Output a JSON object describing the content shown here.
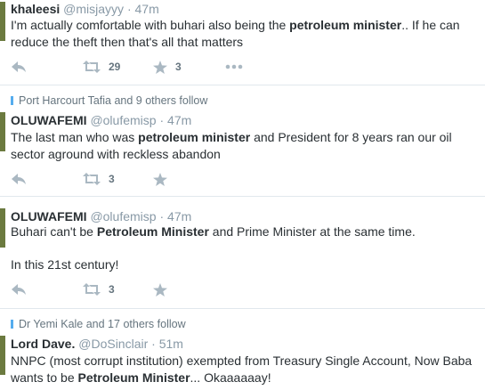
{
  "tweets": [
    {
      "name": "khaleesi",
      "handle": "@misjayyy",
      "dot": "·",
      "time": "47m",
      "text_parts": [
        "I'm actually comfortable with buhari also being the ",
        "petroleum minister",
        ".. If he can reduce the theft then that's all that matters"
      ],
      "retweets": "29",
      "favorites": "3"
    },
    {
      "social": "Port Harcourt Tafia and 9 others follow",
      "name": "OLUWAFEMI",
      "handle": "@olufemisp",
      "dot": "·",
      "time": "47m",
      "text_parts": [
        "The last man who was ",
        "petroleum minister",
        " and President for 8 years ran our oil sector aground with reckless abandon"
      ],
      "retweets": "3"
    },
    {
      "name": "OLUWAFEMI",
      "handle": "@olufemisp",
      "dot": "·",
      "time": "47m",
      "text_parts": [
        "Buhari can't be ",
        "Petroleum Minister",
        " and Prime Minister at the same time."
      ],
      "text_line2": "In this 21st century!",
      "retweets": "3"
    },
    {
      "social": "Dr Yemi Kale and 17 others follow",
      "name": "Lord Dave.",
      "handle": "@DoSinclair",
      "dot": "·",
      "time": "51m",
      "text_parts": [
        "NNPC (most corrupt institution) exempted from Treasury Single Account, Now Baba wants to be ",
        "Petroleum Minister",
        "... Okaaaaaay!"
      ]
    }
  ],
  "colors": {
    "icon": "#aab8c2",
    "border": "#e1e8ed",
    "muted": "#8899a6"
  }
}
